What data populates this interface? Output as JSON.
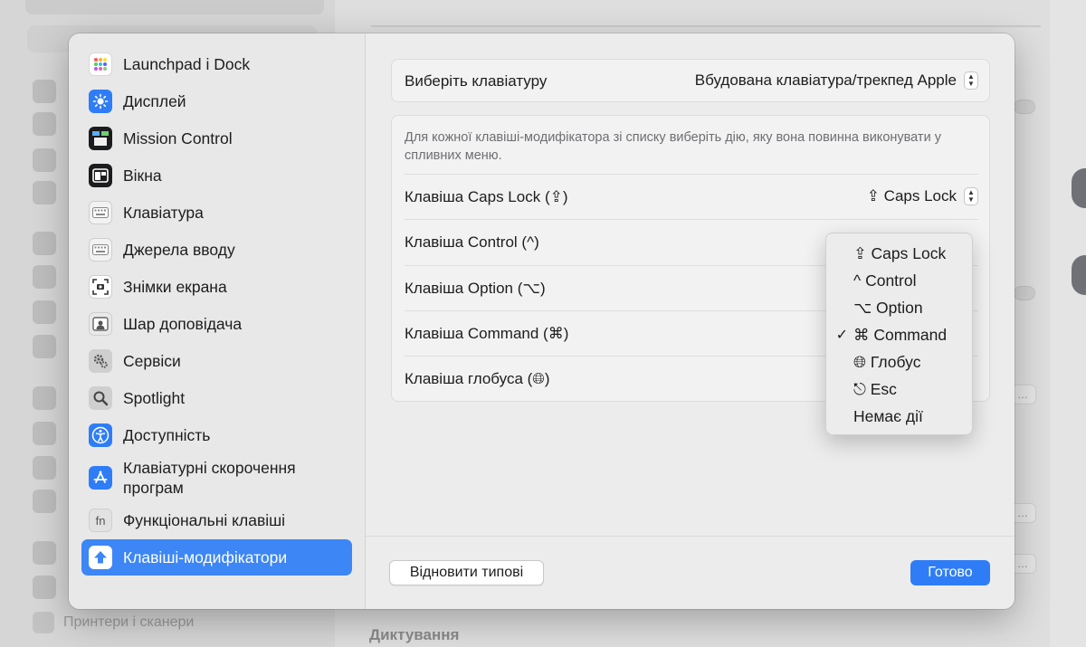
{
  "background": {
    "bottom_sidebar_item": "Принтери і сканери",
    "dictation_heading": "Диктування"
  },
  "sheet": {
    "sidebar": {
      "items": [
        {
          "label": "Launchpad і Dock",
          "icon": "launchpad-icon"
        },
        {
          "label": "Дисплей",
          "icon": "sun-icon"
        },
        {
          "label": "Mission Control",
          "icon": "mission-control-icon"
        },
        {
          "label": "Вікна",
          "icon": "windows-icon"
        },
        {
          "label": "Клавіатура",
          "icon": "keyboard-icon"
        },
        {
          "label": "Джерела вводу",
          "icon": "keyboard-icon"
        },
        {
          "label": "Знімки екрана",
          "icon": "screenshot-icon"
        },
        {
          "label": "Шар доповідача",
          "icon": "presenter-icon"
        },
        {
          "label": "Сервіси",
          "icon": "gears-icon"
        },
        {
          "label": "Spotlight",
          "icon": "magnifier-icon"
        },
        {
          "label": "Доступність",
          "icon": "accessibility-icon"
        },
        {
          "label": "Клавіатурні скорочення програм",
          "icon": "app-store-icon"
        },
        {
          "label": "Функціональні клавіші",
          "icon": "fn-icon",
          "icon_text": "fn"
        },
        {
          "label": "Клавіші-модифікатори",
          "icon": "modifier-arrow-icon",
          "selected": true
        }
      ]
    },
    "main": {
      "keyboard_select": {
        "label": "Виберіть клавіатуру",
        "value": "Вбудована клавіатура/трекпед Apple"
      },
      "description": "Для кожної клавіші-модифікатора зі списку виберіть дію, яку вона повинна виконувати у спливних меню.",
      "rows": [
        {
          "label": "Клавіша Caps Lock (⇪)",
          "value": "⇪ Caps Lock"
        },
        {
          "label": "Клавіша Control (^)",
          "value": ""
        },
        {
          "label": "Клавіша Option (⌥)",
          "value": ""
        },
        {
          "label": "Клавіша Command (⌘)",
          "value": ""
        },
        {
          "label": "Клавіша глобуса (🌐︎)",
          "value": ""
        }
      ],
      "reset_button": "Відновити типові",
      "done_button": "Готово"
    },
    "popup_menu": {
      "items": [
        {
          "label": "⇪ Caps Lock",
          "checked": false
        },
        {
          "label": "^ Control",
          "checked": false
        },
        {
          "label": "⌥ Option",
          "checked": false
        },
        {
          "label": "⌘ Command",
          "checked": true
        },
        {
          "label": "🌐︎ Глобус",
          "checked": false
        },
        {
          "label": "⎋ Esc",
          "checked": false
        },
        {
          "label": "Немає дії",
          "checked": false
        }
      ],
      "check_glyph": "✓"
    }
  },
  "colors": {
    "accent": "#2f7df6",
    "selection": "#3d86f5"
  }
}
